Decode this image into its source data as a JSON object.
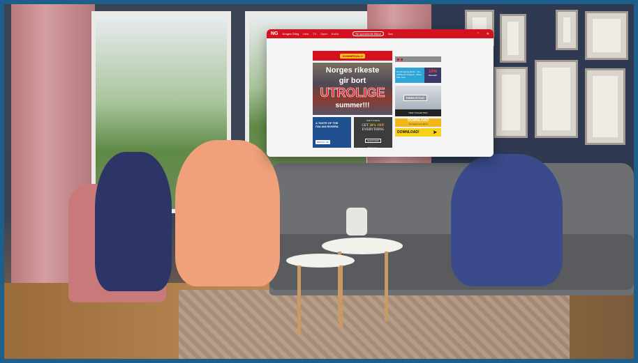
{
  "ar_window": {
    "logo": "NG",
    "site_name": "Norges Grieg",
    "nav": [
      "Idea",
      "TV",
      "Sport",
      "Kultur"
    ],
    "pill_button": "Se spennende tilbud",
    "search": "Søk",
    "controls": [
      "⌃",
      "✕"
    ],
    "promo_badge": "SOMMERSALG",
    "hero": {
      "line1": "Norges rikeste",
      "line2": "gir bort",
      "line3": "UTROLIGE",
      "line4": "summer!!!"
    },
    "card_left": {
      "title": "A TASTE OF THE ITALIAN RIVIERA",
      "button": "BESTILL NÅ"
    },
    "card_right": {
      "top": "ONLY A SALE",
      "offer_pre": "GET",
      "offer_pct": "20% OFF",
      "offer_post": "EVERYTHING",
      "button": "SHOP NOW",
      "link": "Shop now ›"
    },
    "side": {
      "cyan_text": "Hot Shopping Deals – No Additional Charges – Shop Sale Now",
      "discount_pct": "10%",
      "discount_label": "discount",
      "paris_label": "PARIS STYLE",
      "paris_bottom": "NEW COLLECTION",
      "download1": "DOWNLOAD",
      "download1_sub": "Nyt bagel sine tilbud",
      "download2": "DOWNLOAD!"
    },
    "accent": "#d4121f"
  }
}
